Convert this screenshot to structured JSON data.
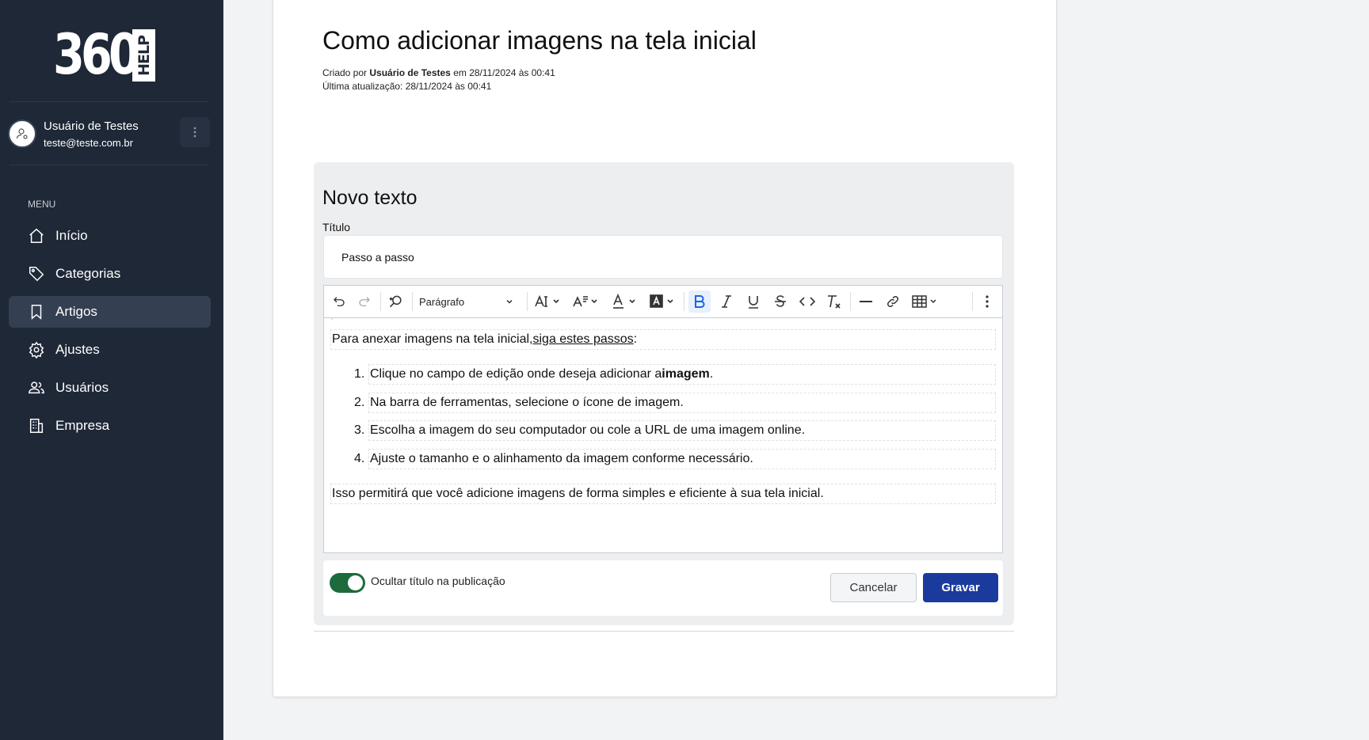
{
  "brand": {
    "logo_number": "360",
    "logo_tag": "HELP"
  },
  "user": {
    "name": "Usuário de Testes",
    "email": "teste@teste.com.br"
  },
  "sidebar": {
    "menu_label": "MENU",
    "items": [
      {
        "label": "Início",
        "icon": "home-icon",
        "active": false
      },
      {
        "label": "Categorias",
        "icon": "tag-icon",
        "active": false
      },
      {
        "label": "Artigos",
        "icon": "bookmark-icon",
        "active": true
      },
      {
        "label": "Ajustes",
        "icon": "gear-icon",
        "active": false
      },
      {
        "label": "Usuários",
        "icon": "users-icon",
        "active": false
      },
      {
        "label": "Empresa",
        "icon": "building-icon",
        "active": false
      }
    ]
  },
  "article": {
    "title": "Como adicionar imagens na tela inicial",
    "created_prefix": "Criado por ",
    "created_by": "Usuário de Testes",
    "created_suffix": " em 28/11/2024 às 00:41",
    "updated": "Última atualização: 28/11/2024 às 00:41"
  },
  "editor_panel": {
    "heading": "Novo texto",
    "title_label": "Título",
    "title_value": "Passo a passo",
    "paragraph_style": "Parágrafo",
    "toolbar_icons": [
      "undo-icon",
      "redo-icon",
      "find-replace-icon",
      "font-size-icon",
      "line-height-icon",
      "font-color-icon",
      "highlight-icon",
      "bold-icon",
      "italic-icon",
      "underline-icon",
      "strikethrough-icon",
      "code-icon",
      "remove-format-icon",
      "horizontal-line-icon",
      "link-icon",
      "table-icon",
      "more-icon"
    ],
    "intro_text": "Para anexar imagens na tela inicial, ",
    "intro_link": "siga estes passos",
    "intro_end": ":",
    "steps": [
      {
        "num": "1.",
        "text": "Clique no campo de edição onde deseja adicionar a ",
        "bold": "imagem",
        "end": "."
      },
      {
        "num": "2.",
        "text": "Na barra de ferramentas, selecione o ícone de imagem.",
        "bold": "",
        "end": ""
      },
      {
        "num": "3.",
        "text": "Escolha a imagem do seu computador ou cole a URL de uma imagem online.",
        "bold": "",
        "end": ""
      },
      {
        "num": "4.",
        "text": "Ajuste o tamanho e o alinhamento da imagem conforme necessário.",
        "bold": "",
        "end": ""
      }
    ],
    "outro_text": "Isso permitirá que você adicione imagens de forma simples e eficiente à sua tela inicial.",
    "hide_title_label": "Ocultar título na publicação",
    "hide_title_on": true,
    "cancel_label": "Cancelar",
    "save_label": "Gravar"
  },
  "colors": {
    "sidebar": "#1f2837",
    "toggle_on": "#1d6b3c",
    "primary": "#1b3a9e"
  }
}
